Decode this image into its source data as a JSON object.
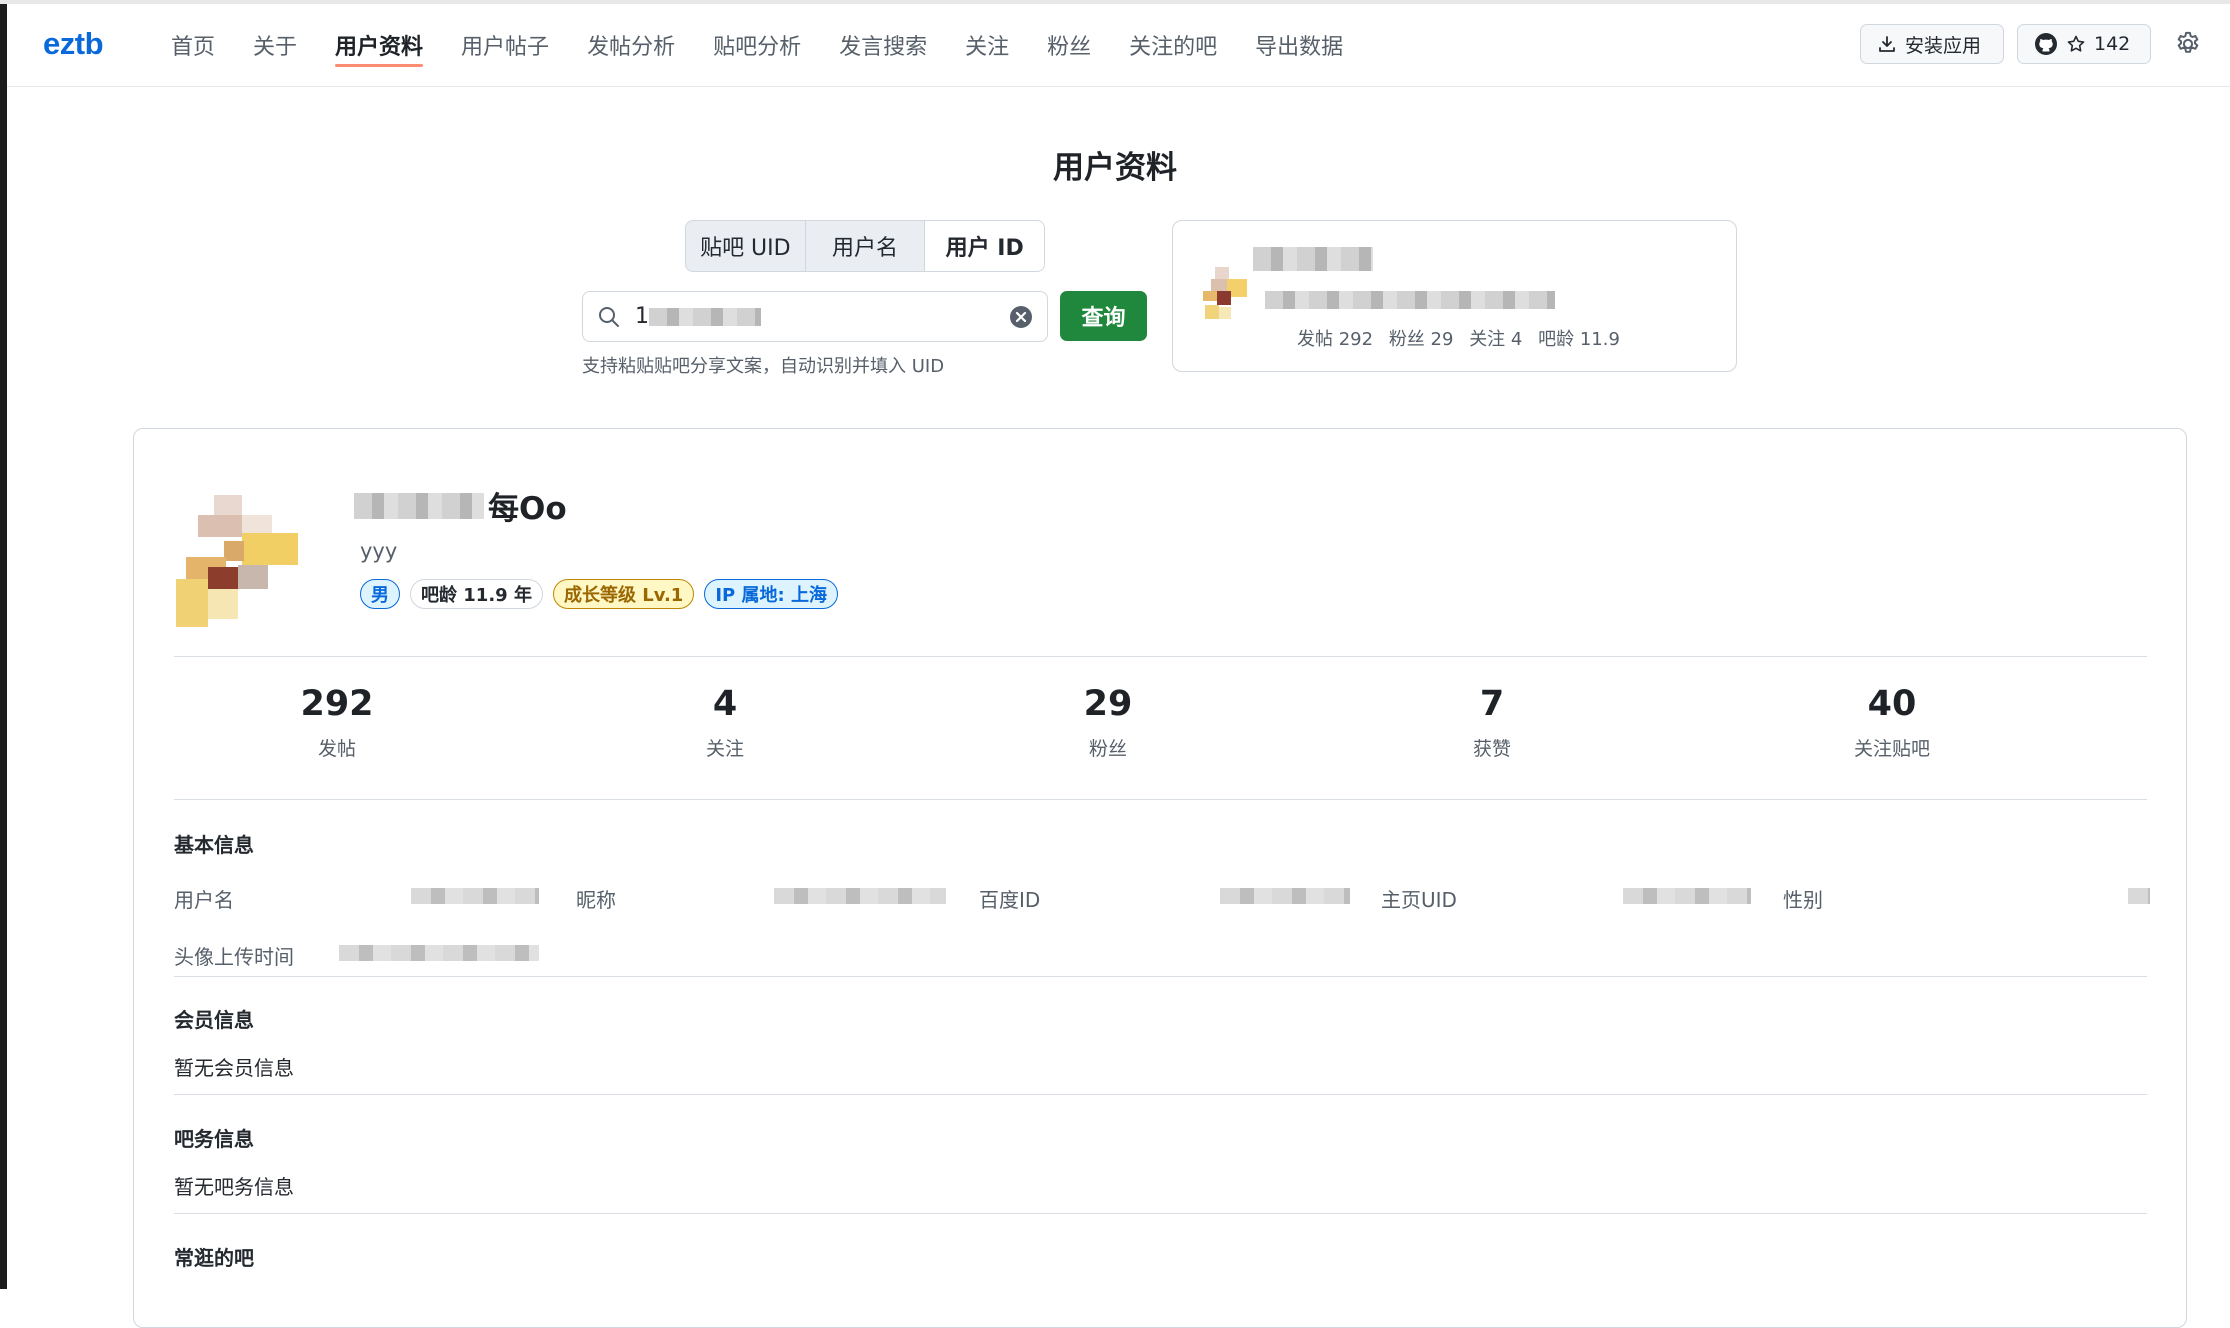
{
  "nav": {
    "logo": "eztb",
    "items": [
      "首页",
      "关于",
      "用户资料",
      "用户帖子",
      "发帖分析",
      "贴吧分析",
      "发言搜索",
      "关注",
      "粉丝",
      "关注的吧",
      "导出数据"
    ],
    "active_index": 2,
    "install_label": "安装应用",
    "star_count": "142"
  },
  "page": {
    "title": "用户资料"
  },
  "search": {
    "modes": [
      "贴吧 UID",
      "用户名",
      "用户 ID"
    ],
    "active_mode": 2,
    "value_prefix": "1",
    "button_label": "查询",
    "hint": "支持粘贴贴吧分享文案，自动识别并填入 UID"
  },
  "preview": {
    "stats": [
      "发帖 292",
      "粉丝 29",
      "关注 4",
      "吧龄 11.9"
    ]
  },
  "profile": {
    "name_suffix": "每Oo",
    "bio": "yyy",
    "badges": [
      {
        "text": "男",
        "style": "blue"
      },
      {
        "text": "吧龄 11.9 年",
        "style": "gray"
      },
      {
        "text": "成长等级 Lv.1",
        "style": "gold"
      },
      {
        "text": "IP 属地: 上海",
        "style": "blue"
      }
    ]
  },
  "stats": [
    {
      "value": "292",
      "label": "发帖"
    },
    {
      "value": "4",
      "label": "关注"
    },
    {
      "value": "29",
      "label": "粉丝"
    },
    {
      "value": "7",
      "label": "获赞"
    },
    {
      "value": "40",
      "label": "关注贴吧"
    }
  ],
  "basic": {
    "title": "基本信息",
    "labels": [
      "用户名",
      "昵称",
      "百度ID",
      "主页UID",
      "性别",
      "头像上传时间"
    ]
  },
  "member": {
    "title": "会员信息",
    "empty": "暂无会员信息"
  },
  "moderator": {
    "title": "吧务信息",
    "empty": "暂无吧务信息"
  },
  "frequent": {
    "title": "常逛的吧"
  },
  "colors": {
    "accent": "#0969da",
    "primary_button": "#1f883d",
    "active_underline": "#fd8c73"
  }
}
